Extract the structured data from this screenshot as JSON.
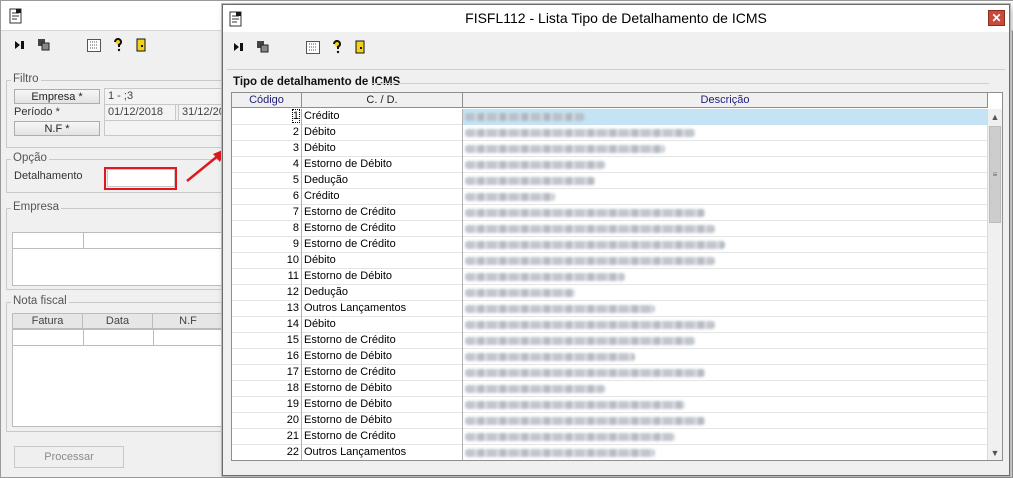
{
  "background_window": {
    "filtro": {
      "group_label": "Filtro",
      "empresa_button": "Empresa *",
      "empresa_value": "1 - ;3",
      "periodo_label": "Período *",
      "periodo_start": "01/12/2018",
      "periodo_end": "31/12/20",
      "nf_button": "N.F *"
    },
    "opcao": {
      "group_label": "Opção",
      "detalhamento_label": "Detalhamento"
    },
    "empresa_group_label": "Empresa",
    "nota_fiscal": {
      "group_label": "Nota fiscal",
      "columns": [
        "Fatura",
        "Data",
        "N.F"
      ]
    },
    "processar_button": "Processar"
  },
  "dialog": {
    "title": "FISFL112 - Lista Tipo de Detalhamento de ICMS",
    "close_glyph": "✕",
    "group_title": "Tipo de detalhamento de ICMS",
    "columns": {
      "codigo": "Código",
      "cd": "C. / D.",
      "descricao": "Descrição"
    },
    "rows": [
      {
        "code": "1",
        "type": "Crédito"
      },
      {
        "code": "2",
        "type": "Débito"
      },
      {
        "code": "3",
        "type": "Débito"
      },
      {
        "code": "4",
        "type": "Estorno de Débito"
      },
      {
        "code": "5",
        "type": "Dedução"
      },
      {
        "code": "6",
        "type": "Crédito"
      },
      {
        "code": "7",
        "type": "Estorno de Crédito"
      },
      {
        "code": "8",
        "type": "Estorno de Crédito"
      },
      {
        "code": "9",
        "type": "Estorno de Crédito"
      },
      {
        "code": "10",
        "type": "Débito"
      },
      {
        "code": "11",
        "type": "Estorno de Débito"
      },
      {
        "code": "12",
        "type": "Dedução"
      },
      {
        "code": "13",
        "type": "Outros Lançamentos"
      },
      {
        "code": "14",
        "type": "Débito"
      },
      {
        "code": "15",
        "type": "Estorno de Crédito"
      },
      {
        "code": "16",
        "type": "Estorno de Débito"
      },
      {
        "code": "17",
        "type": "Estorno de Crédito"
      },
      {
        "code": "18",
        "type": "Estorno de Débito"
      },
      {
        "code": "19",
        "type": "Estorno de Débito"
      },
      {
        "code": "20",
        "type": "Estorno de Débito"
      },
      {
        "code": "21",
        "type": "Estorno de Crédito"
      },
      {
        "code": "22",
        "type": "Outros Lançamentos"
      }
    ],
    "selected_code": "1"
  },
  "colors": {
    "highlight": "#e0171d",
    "selection": "#c4e3f5",
    "header_text": "#1d1d7a"
  }
}
